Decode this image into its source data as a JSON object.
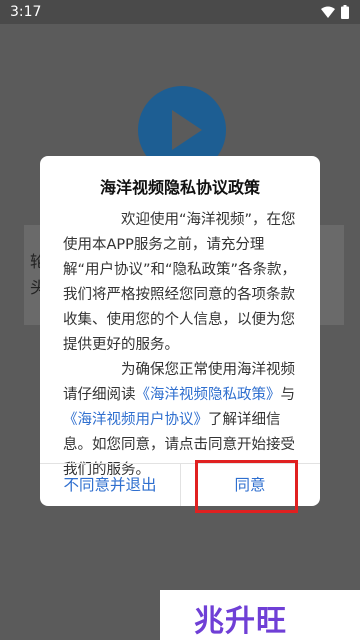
{
  "status_bar": {
    "time": "3:17"
  },
  "background": {
    "line1": "轮",
    "line2": "头"
  },
  "dialog": {
    "title": "海洋视频隐私协议政策",
    "para1": "欢迎使用“海洋视频”，在您使用本APP服务之前，请充分理解“用户协议”和“隐私政策”各条款，我们将严格按照经您同意的各项条款收集、使用您的个人信息，以便为您提供更好的服务。",
    "para2_prefix": "为确保您正常使用海洋视频请仔细阅读",
    "privacy_link": "《海洋视频隐私政策》",
    "connector": "与",
    "user_agreement_link": "《海洋视频用户协议》",
    "para2_suffix": "了解详细信息。如您同意，请点击同意开始接受我们的服务。",
    "decline_label": "不同意并退出",
    "agree_label": "同意"
  },
  "watermark": {
    "text": "兆升旺"
  },
  "colors": {
    "link": "#2f6fcf",
    "highlight": "#e02020",
    "play_button": "#1d5e93"
  }
}
